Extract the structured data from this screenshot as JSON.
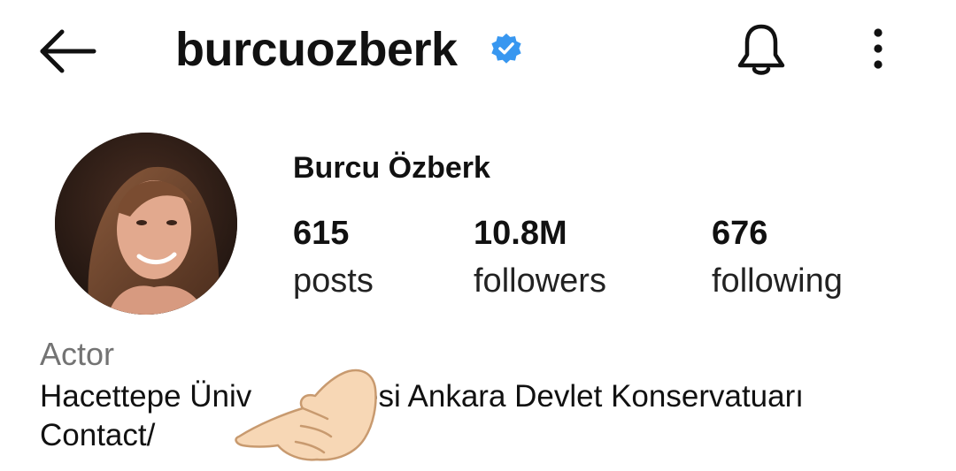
{
  "header": {
    "username": "burcuozberk",
    "back_icon": "arrow-left-icon",
    "verified_icon": "verified-badge-icon",
    "verified_color": "#3897f0",
    "bell_icon": "bell-icon",
    "more_icon": "more-vertical-icon"
  },
  "profile": {
    "full_name": "Burcu Özberk",
    "stats": [
      {
        "value": "615",
        "label": "posts"
      },
      {
        "value": "10.8M",
        "label": "followers"
      },
      {
        "value": "676",
        "label": "following"
      }
    ],
    "category": "Actor",
    "bio_line1": "Hacettepe Üniv",
    "bio_line1_end": "esi Ankara Devlet Konservatuarı",
    "bio_line2": "Contact/"
  },
  "overlay": {
    "pointing_hand_icon": "pointing-hand-emoji-icon"
  }
}
